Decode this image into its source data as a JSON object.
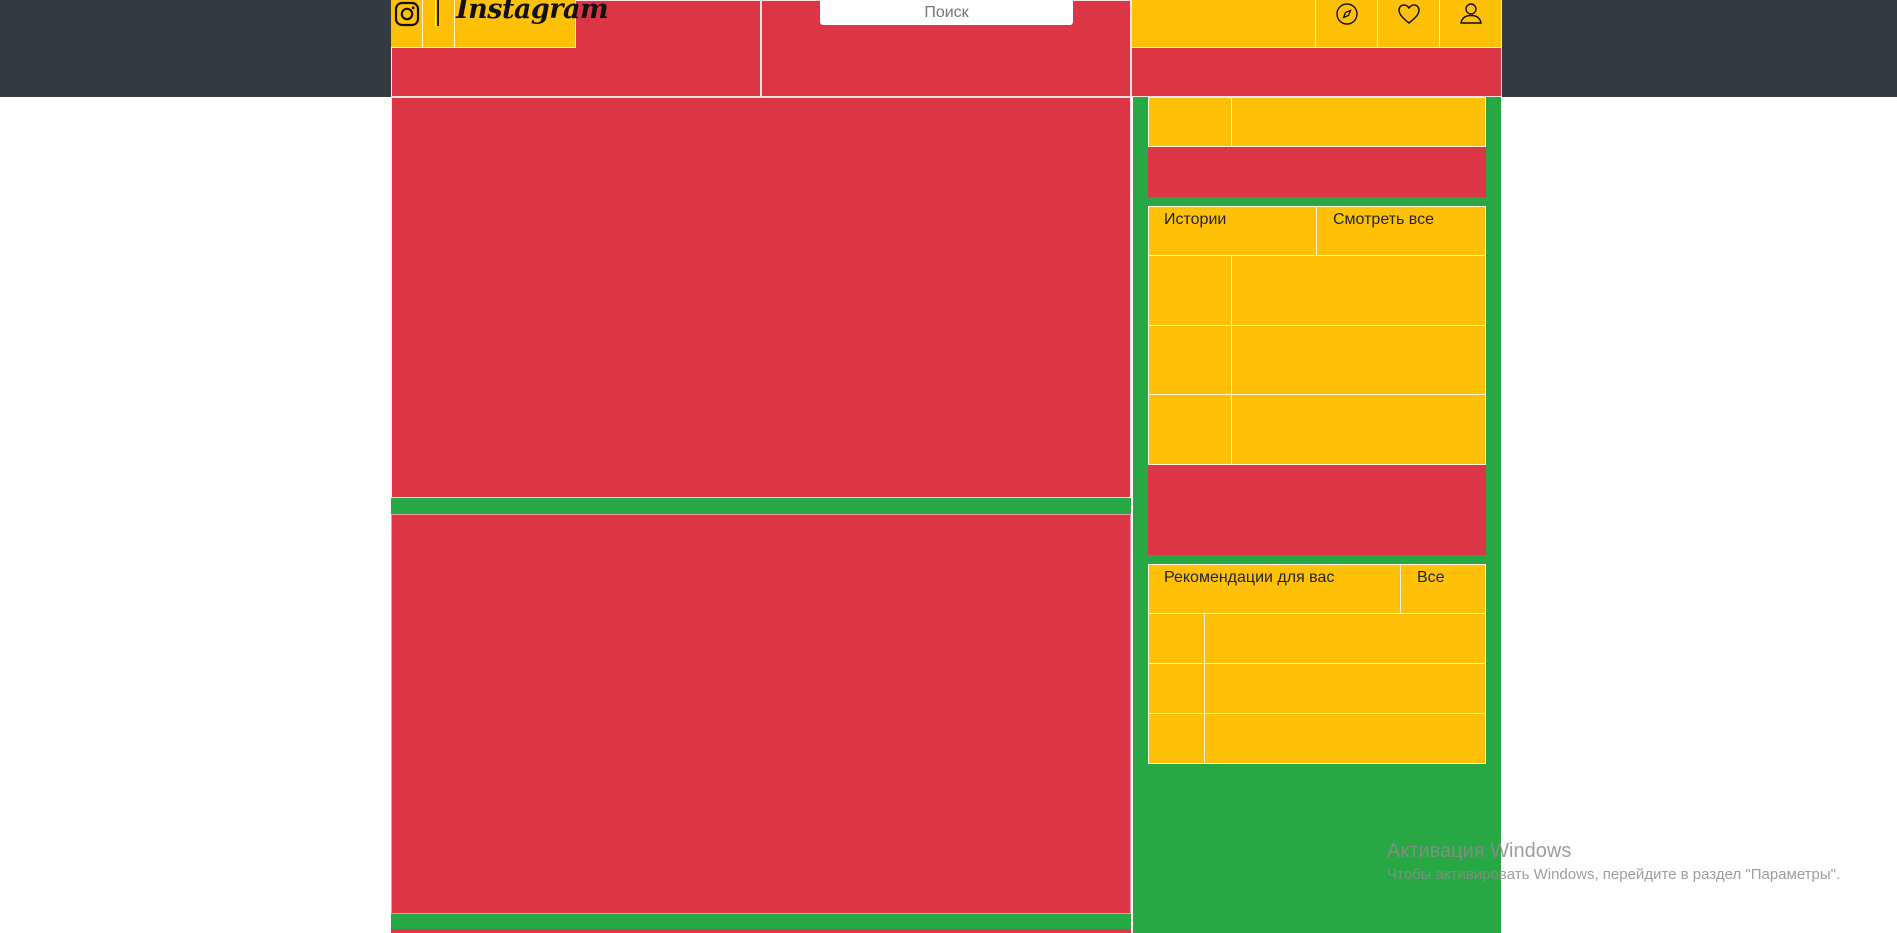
{
  "header": {
    "brand_logo_text": "Instagram",
    "search": {
      "placeholder": "Поиск"
    },
    "icons": [
      "instagram-icon",
      "compass-icon",
      "heart-icon",
      "user-icon"
    ]
  },
  "sidebar": {
    "stories": {
      "title": "Истории",
      "see_all": "Смотреть все"
    },
    "recommendations": {
      "title": "Рекомендации для вас",
      "see_all": "Все"
    }
  },
  "watermark": {
    "title": "Активация Windows",
    "subtitle": "Чтобы активировать Windows, перейдите в раздел \"Параметры\"."
  },
  "colors": {
    "header_bg": "#343a40",
    "red": "#dc3545",
    "yellow": "#ffc107",
    "green": "#28a745"
  }
}
